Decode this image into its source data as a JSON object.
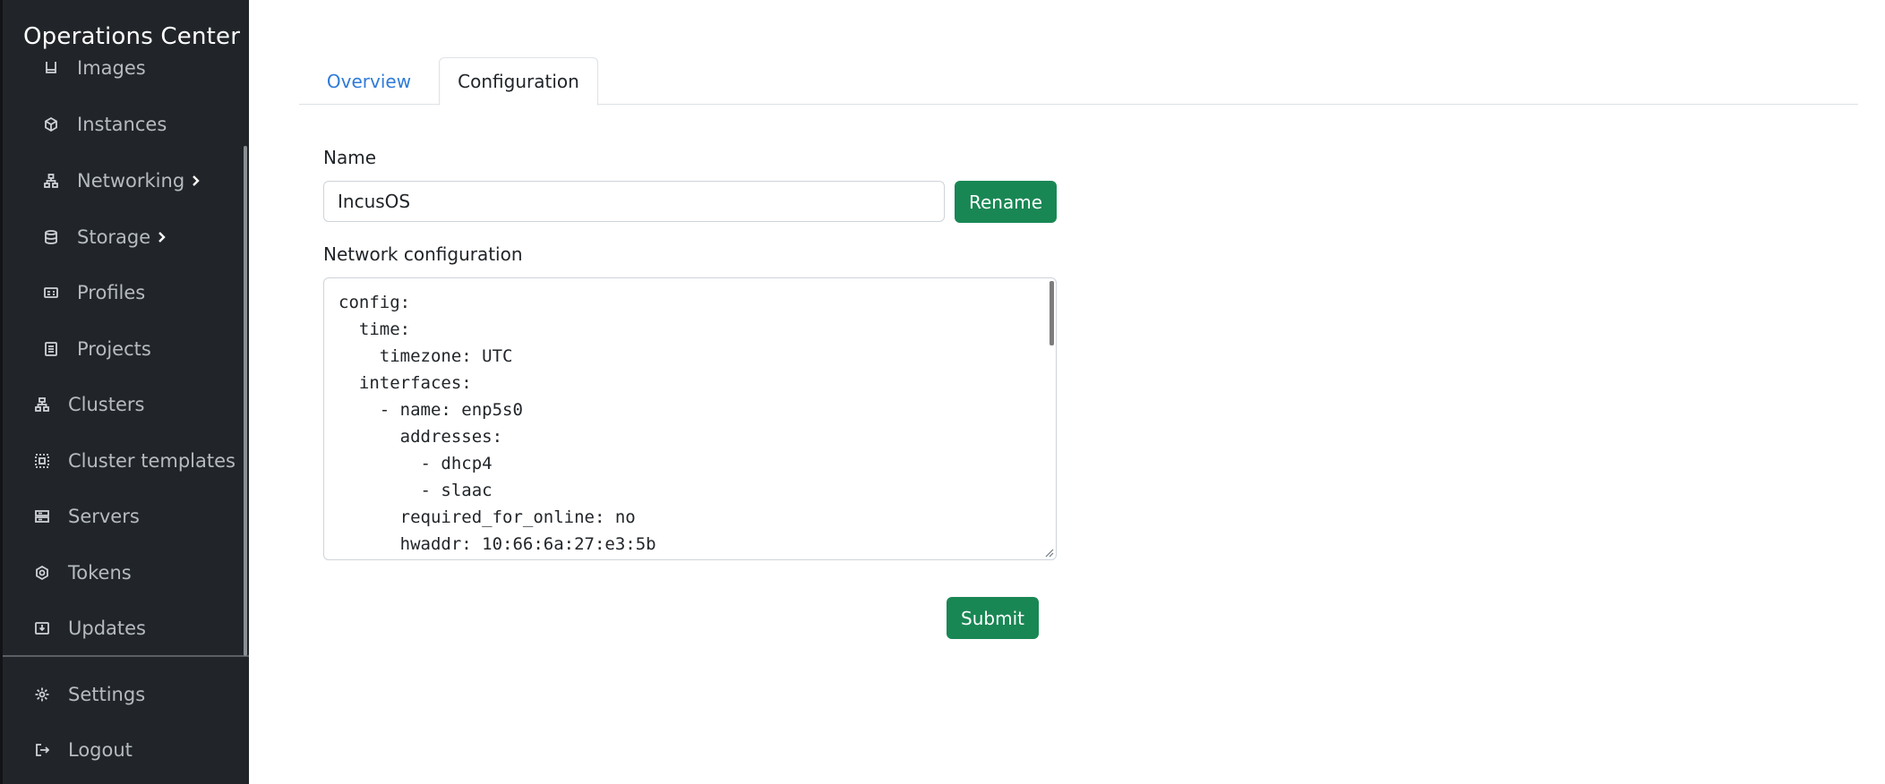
{
  "app": {
    "title": "Operations Center"
  },
  "sidebar": {
    "items": [
      {
        "label": "Images",
        "icon": "image-icon",
        "level": "sub"
      },
      {
        "label": "Instances",
        "icon": "cube-icon",
        "level": "sub"
      },
      {
        "label": "Networking",
        "icon": "network-icon",
        "level": "sub",
        "has_chevron": true
      },
      {
        "label": "Storage",
        "icon": "database-icon",
        "level": "sub",
        "has_chevron": true
      },
      {
        "label": "Profiles",
        "icon": "id-card-icon",
        "level": "sub"
      },
      {
        "label": "Projects",
        "icon": "document-icon",
        "level": "sub"
      },
      {
        "label": "Clusters",
        "icon": "cluster-icon",
        "level": "top"
      },
      {
        "label": "Cluster templates",
        "icon": "template-icon",
        "level": "top"
      },
      {
        "label": "Servers",
        "icon": "server-icon",
        "level": "top"
      },
      {
        "label": "Tokens",
        "icon": "token-icon",
        "level": "top"
      },
      {
        "label": "Updates",
        "icon": "download-icon",
        "level": "top"
      }
    ],
    "footer": [
      {
        "label": "Settings",
        "icon": "gear-icon"
      },
      {
        "label": "Logout",
        "icon": "logout-icon"
      }
    ]
  },
  "tabs": [
    {
      "label": "Overview",
      "active": false
    },
    {
      "label": "Configuration",
      "active": true
    }
  ],
  "form": {
    "name_label": "Name",
    "name_value": "IncusOS",
    "rename_label": "Rename",
    "network_label": "Network configuration",
    "network_config": "config:\n  time:\n    timezone: UTC\n  interfaces:\n    - name: enp5s0\n      addresses:\n        - dhcp4\n        - slaac\n      required_for_online: no\n      hwaddr: 10:66:6a:27:e3:5b",
    "submit_label": "Submit"
  },
  "colors": {
    "sidebar_bg": "#212529",
    "button_green": "#198754",
    "link_blue": "#2f7bd8"
  }
}
